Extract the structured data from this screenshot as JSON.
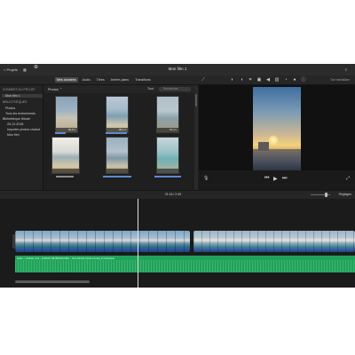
{
  "titlebar": {
    "projects_label": "< Projets",
    "title": "Mon film 1"
  },
  "toolbar": {
    "tabs": [
      "Mes données",
      "Audio",
      "Titres",
      "Arrière-plans",
      "Transitions"
    ],
    "reset_label": "Tout réinitialiser"
  },
  "sidebar": {
    "project_header": "DONNÉES DU PROJET",
    "project_item": "Mon film 1",
    "libraries_header": "BIBLIOTHÈQUES",
    "items": [
      "Photos",
      "Tous les événements",
      "Bibliothèque iMovie",
      "26-12-2018",
      "Importer photos chariot",
      "Mon film"
    ]
  },
  "browser": {
    "dropdown": "Photos",
    "all_label": "Tout",
    "search_placeholder": "Rechercher",
    "clips": [
      {
        "duration": "30,8 s"
      },
      {
        "duration": "30,1 s"
      },
      {
        "duration": "15,4 s"
      },
      {
        "duration": ""
      },
      {
        "duration": ""
      },
      {
        "duration": ""
      }
    ]
  },
  "timebar": {
    "timecode": "21:16 / 2:49",
    "settings_label": "Réglages"
  },
  "timeline": {
    "audio_label": "Hello – Unlikely Link – ECRAN DE BRANCHES – Soundtrack (Instrumental_Fr)-Musique"
  },
  "icons": [
    "grid-icon",
    "import-icon",
    "share-icon",
    "wand-icon",
    "color-icon",
    "crop-icon",
    "camera-icon",
    "volume-icon",
    "speed-icon",
    "noise-icon",
    "info-icon",
    "mic-icon",
    "fullscreen-icon"
  ]
}
